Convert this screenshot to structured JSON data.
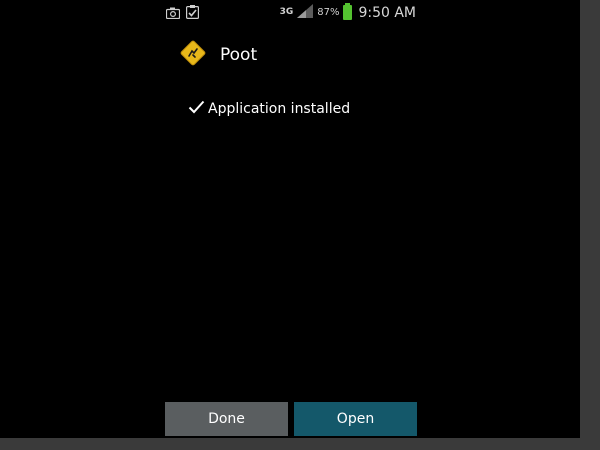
{
  "status_bar": {
    "icons_left": [
      "camera-icon",
      "clipboard-check-icon"
    ],
    "network": "3G",
    "battery_percent": "87%",
    "battery_level": 0.87,
    "time": "9:50 AM"
  },
  "app": {
    "name": "Poot",
    "icon": "poot-app-icon"
  },
  "install_status": {
    "icon": "checkmark-icon",
    "text": "Application installed"
  },
  "buttons": {
    "done_label": "Done",
    "open_label": "Open"
  },
  "colors": {
    "background": "#000000",
    "battery": "#54c230",
    "done_button": "#5a5e60",
    "open_button": "#14586a",
    "app_icon": "#e8b81a"
  }
}
